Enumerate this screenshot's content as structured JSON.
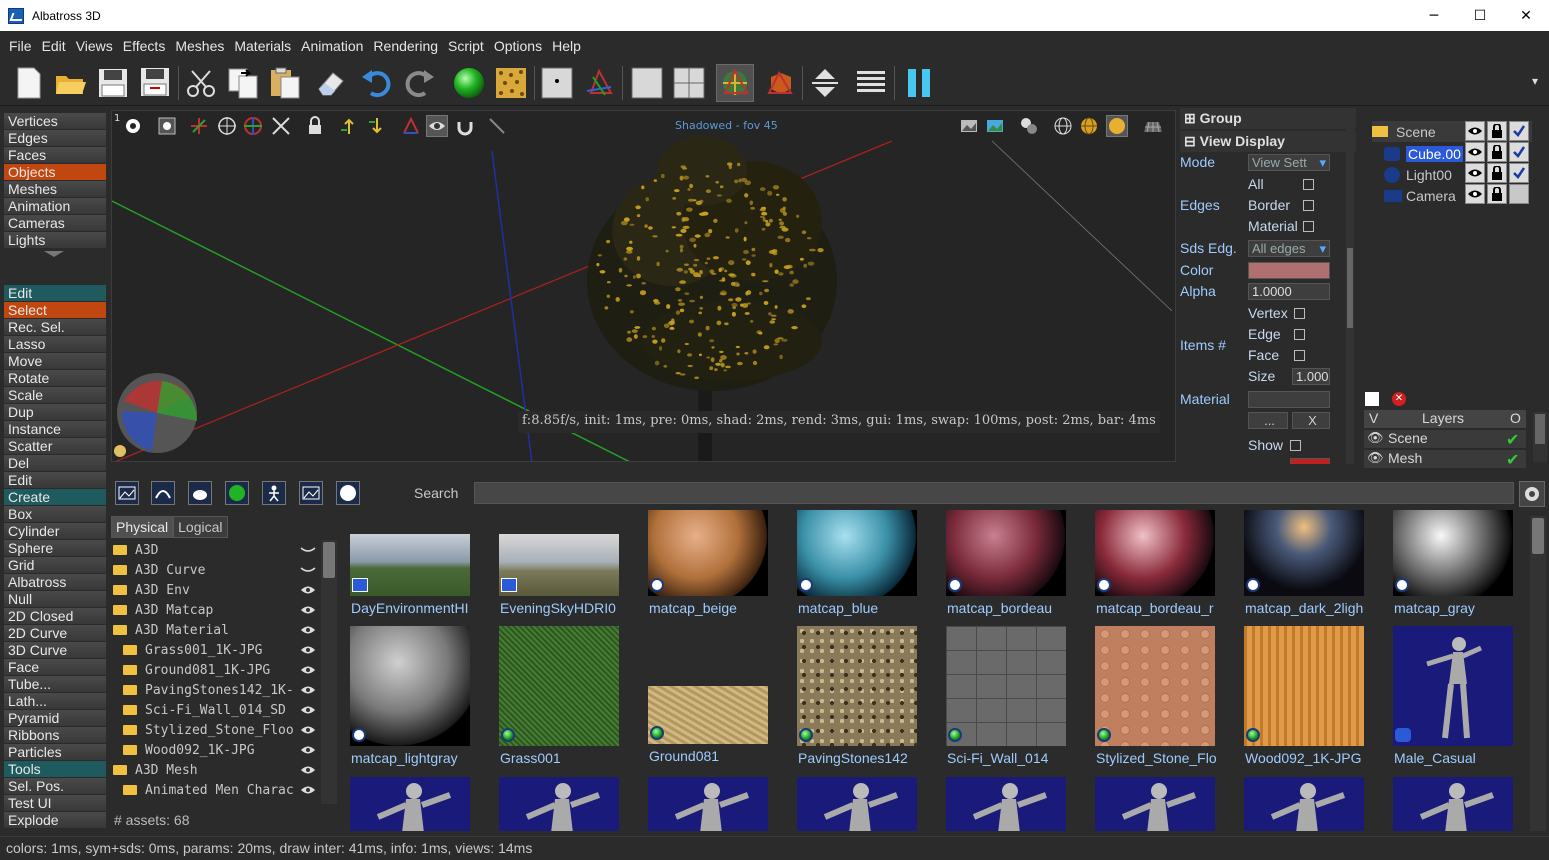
{
  "window": {
    "title": "Albatross 3D",
    "minimize": "─",
    "maximize": "☐",
    "close": "✕"
  },
  "menu": [
    "File",
    "Edit",
    "Views",
    "Effects",
    "Meshes",
    "Materials",
    "Animation",
    "Rendering",
    "Script",
    "Options",
    "Help"
  ],
  "toolbar_overflow": "▾",
  "left_panel": {
    "selection_modes": [
      "Vertices",
      "Edges",
      "Faces",
      "Objects",
      "Meshes",
      "Animation",
      "Cameras",
      "Lights"
    ],
    "selected_mode": "Objects",
    "edit_header": "Edit",
    "edit_items": [
      "Select",
      "Rec. Sel.",
      "Lasso",
      "Move",
      "Rotate",
      "Scale",
      "Dup",
      "Instance",
      "Scatter",
      "Del",
      "Edit"
    ],
    "selected_edit": "Select",
    "create_header": "Create",
    "create_items": [
      "Box",
      "Cylinder",
      "Sphere",
      "Grid",
      "Albatross",
      "Null",
      "2D Closed",
      "2D Curve",
      "3D Curve",
      "Face",
      "Tube...",
      "Lath...",
      "Pyramid",
      "Ribbons",
      "Particles"
    ],
    "tools_header": "Tools",
    "tools_items": [
      "Sel. Pos.",
      "Test UI",
      "Explode"
    ]
  },
  "viewport": {
    "corner_number": "1",
    "label": "Shadowed - fov 45",
    "stats": "f:8.85f/s, init: 1ms, pre: 0ms, shad: 2ms, rend: 3ms, gui: 1ms, swap: 100ms, post: 2ms, bar: 4ms"
  },
  "properties": {
    "group_header": "Group",
    "view_display_header": "View Display",
    "mode_label": "Mode",
    "mode_value": "View Sett",
    "all_label": "All",
    "edges_label": "Edges",
    "border_label": "Border",
    "material_check_label": "Material",
    "sds_edg_label": "Sds Edg.",
    "sds_edg_value": "All edges",
    "color_label": "Color",
    "alpha_label": "Alpha",
    "alpha_value": "1.0000",
    "items_label": "Items #",
    "vertex_label": "Vertex",
    "edge_label": "Edge",
    "face_label": "Face",
    "size_label": "Size",
    "size_value": "1.000",
    "material_label": "Material",
    "dots_button": "...",
    "x_button": "X",
    "show_label": "Show",
    "color_value": "#b07070"
  },
  "scene": {
    "items": [
      {
        "name": "Scene",
        "checked": true
      },
      {
        "name": "Cube.00",
        "checked": true,
        "selected": true
      },
      {
        "name": "Light00",
        "checked": true
      },
      {
        "name": "Camera",
        "checked": false
      }
    ]
  },
  "layers": {
    "col_v": "V",
    "header": "Layers",
    "col_o": "O",
    "rows": [
      {
        "name": "Scene",
        "checked": true
      },
      {
        "name": "Mesh",
        "checked": true
      }
    ]
  },
  "assets": {
    "search_label": "Search",
    "tabs": [
      "Physical",
      "Logical"
    ],
    "active_tab": "Physical",
    "tree": [
      {
        "label": "A3D",
        "depth": 0
      },
      {
        "label": "A3D Curve",
        "depth": 0
      },
      {
        "label": "A3D Env",
        "depth": 0
      },
      {
        "label": "A3D Matcap",
        "depth": 0
      },
      {
        "label": "A3D Material",
        "depth": 0
      },
      {
        "label": "Grass001_1K-JPG",
        "depth": 1
      },
      {
        "label": "Ground081_1K-JPG",
        "depth": 1
      },
      {
        "label": "PavingStones142_1K-",
        "depth": 1
      },
      {
        "label": "Sci-Fi_Wall_014_SD",
        "depth": 1
      },
      {
        "label": "Stylized_Stone_Floo",
        "depth": 1
      },
      {
        "label": "Wood092_1K-JPG",
        "depth": 1
      },
      {
        "label": "A3D Mesh",
        "depth": 0
      },
      {
        "label": "Animated Men Charac",
        "depth": 1
      }
    ],
    "count": "# assets: 68",
    "row1": [
      "DayEnvironmentHI",
      "EveningSkyHDRI0",
      "matcap_beige",
      "matcap_blue",
      "matcap_bordeau",
      "matcap_bordeau_r",
      "matcap_dark_2ligh",
      "matcap_gray"
    ],
    "row2": [
      "matcap_lightgray",
      "Grass001",
      "Ground081",
      "PavingStones142",
      "Sci-Fi_Wall_014",
      "Stylized_Stone_Flo",
      "Wood092_1K-JPG",
      "Male_Casual"
    ]
  },
  "status": "colors: 1ms, sym+sds: 0ms, params: 20ms, draw inter: 41ms, info: 1ms, views: 14ms"
}
